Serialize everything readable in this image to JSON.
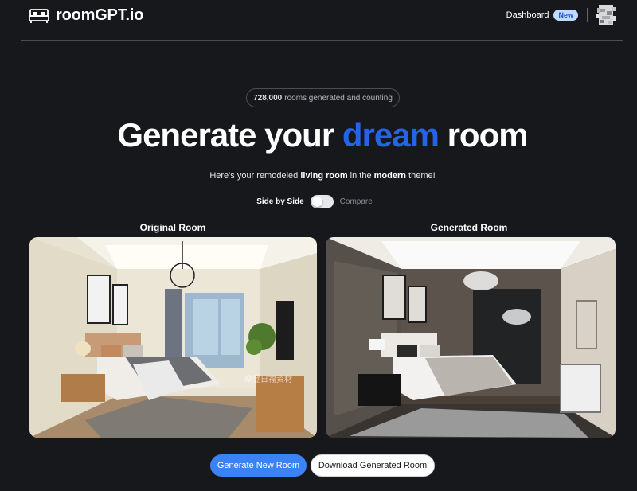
{
  "header": {
    "brand": "roomGPT.io",
    "logo_icon": "bed-icon",
    "dashboard_label": "Dashboard",
    "new_badge": "New",
    "avatar_icon": "avatar-icon"
  },
  "hero": {
    "counter_count": "728,000",
    "counter_text": "rooms generated and counting",
    "title_part1": "Generate your ",
    "title_accent": "dream",
    "title_part2": " room",
    "subtitle_pre": "Here's your remodeled ",
    "subtitle_room": "living room",
    "subtitle_mid": " in the ",
    "subtitle_theme": "modern",
    "subtitle_post": " theme!"
  },
  "toggle": {
    "left_label": "Side by Side",
    "right_label": "Compare",
    "state": "side-by-side"
  },
  "rooms": {
    "original_label": "Original Room",
    "generated_label": "Generated Room",
    "watermark": "摩登日福资材"
  },
  "actions": {
    "generate_label": "Generate New Room",
    "download_label": "Download Generated Room"
  },
  "colors": {
    "background": "#17181c",
    "accent": "#2563eb",
    "primary_button": "#3b82f6"
  }
}
